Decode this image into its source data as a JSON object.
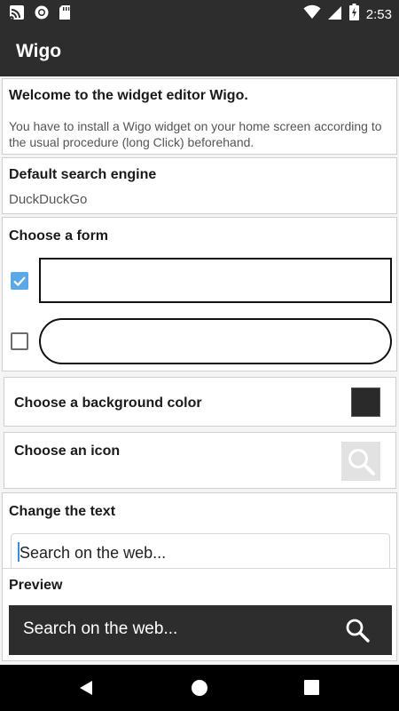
{
  "status_bar": {
    "time": "2:53",
    "left_icons": [
      "cast-icon",
      "record-icon",
      "sd-card-icon"
    ],
    "right_icons": [
      "wifi-icon",
      "signal-icon",
      "battery-icon"
    ]
  },
  "app_bar": {
    "title": "Wigo"
  },
  "welcome": {
    "title": "Welcome to the widget editor Wigo.",
    "text": "You have to install a Wigo widget on your home screen according to the usual procedure (long Click) beforehand."
  },
  "search_engine": {
    "title": "Default search engine",
    "value": "DuckDuckGo"
  },
  "form": {
    "title": "Choose a form",
    "options": [
      {
        "shape": "rectangle",
        "checked": true
      },
      {
        "shape": "rounded",
        "checked": false
      }
    ]
  },
  "background_color": {
    "label": "Choose a background color",
    "color": "#2a2a2a"
  },
  "icon_choice": {
    "label": "Choose an icon",
    "icon": "search-icon"
  },
  "text_change": {
    "title": "Change the text",
    "value": "Search on the web..."
  },
  "preview": {
    "title": "Preview",
    "text": "Search on the web...",
    "icon": "search-icon"
  },
  "nav_bar": {
    "buttons": [
      "back-icon",
      "home-icon",
      "recents-icon"
    ]
  }
}
